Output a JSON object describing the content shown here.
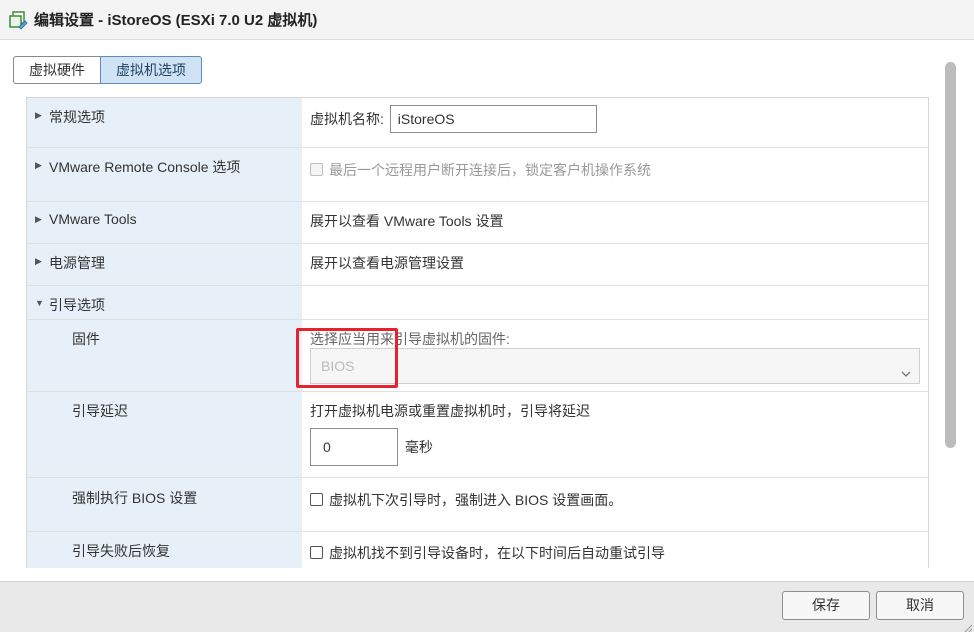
{
  "window": {
    "title": "编辑设置 - iStoreOS (ESXi 7.0 U2 虚拟机)"
  },
  "tabs": [
    {
      "label": "虚拟硬件",
      "active": false
    },
    {
      "label": "虚拟机选项",
      "active": true
    }
  ],
  "rows": {
    "general": {
      "label": "常规选项",
      "vm_name_label": "虚拟机名称:",
      "vm_name_value": "iStoreOS"
    },
    "vmrc": {
      "label": "VMware Remote Console 选项",
      "lock_label": "最后一个远程用户断开连接后，锁定客户机操作系统",
      "lock_checked": false
    },
    "tools": {
      "label": "VMware Tools",
      "value": "展开以查看 VMware Tools 设置"
    },
    "power": {
      "label": "电源管理",
      "value": "展开以查看电源管理设置"
    },
    "boot": {
      "label": "引导选项"
    },
    "firmware": {
      "label": "固件",
      "prompt": "选择应当用来引导虚拟机的固件:",
      "selected": "BIOS"
    },
    "boot_delay": {
      "label": "引导延迟",
      "prompt": "打开虚拟机电源或重置虚拟机时，引导将延迟",
      "value": "0",
      "unit": "毫秒"
    },
    "force_bios": {
      "label": "强制执行 BIOS 设置",
      "checkbox_label": "虚拟机下次引导时，强制进入 BIOS 设置画面。",
      "checked": false
    },
    "boot_retry": {
      "label": "引导失败后恢复",
      "checkbox_label": "虚拟机找不到引导设备时，在以下时间后自动重试引导",
      "checked": false
    }
  },
  "footer": {
    "save_label": "保存",
    "cancel_label": "取消"
  },
  "colors": {
    "accent_tab": "#cfe3f5",
    "label_column": "#e7f0f8",
    "highlight": "#e8212f"
  },
  "icons": {
    "title": "vm-edit-icon",
    "expand": "caret-right-icon",
    "collapse": "caret-down-icon",
    "select": "chevron-down-icon"
  }
}
